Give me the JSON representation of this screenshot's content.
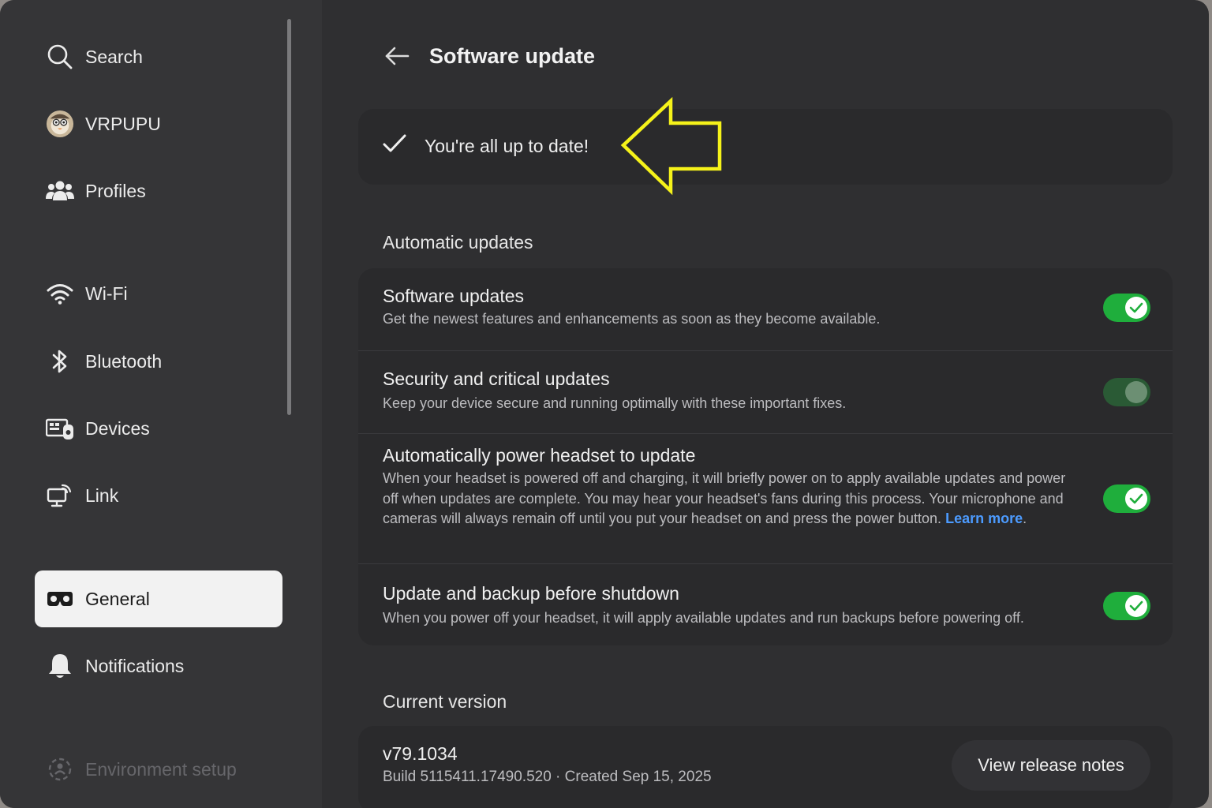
{
  "sidebar": {
    "items": [
      {
        "label": "Search",
        "icon": "search-icon"
      },
      {
        "label": "VRPUPU",
        "icon": "avatar"
      },
      {
        "label": "Profiles",
        "icon": "people-icon"
      },
      {
        "label": "Wi-Fi",
        "icon": "wifi-icon"
      },
      {
        "label": "Bluetooth",
        "icon": "bluetooth-icon"
      },
      {
        "label": "Devices",
        "icon": "devices-icon"
      },
      {
        "label": "Link",
        "icon": "link-icon"
      },
      {
        "label": "General",
        "icon": "headset-icon",
        "active": true
      },
      {
        "label": "Notifications",
        "icon": "bell-icon"
      },
      {
        "label": "Environment setup",
        "icon": "environment-icon",
        "disabled": true
      }
    ]
  },
  "header": {
    "title": "Software update"
  },
  "status": {
    "text": "You're all up to date!"
  },
  "automatic_updates": {
    "section_title": "Automatic updates",
    "rows": [
      {
        "title": "Software updates",
        "description": "Get the newest features and enhancements as soon as they become available.",
        "enabled": true
      },
      {
        "title": "Security and critical updates",
        "description": "Keep your device secure and running optimally with these important fixes.",
        "enabled": true,
        "locked": true
      },
      {
        "title": "Automatically power headset to update",
        "description": "When your headset is powered off and charging, it will briefly power on to apply available updates and power off when updates are complete. You may hear your headset's fans during this process. Your microphone and cameras will always remain off until you put your headset on and press the power button.",
        "link": "Learn more",
        "link_suffix": ".",
        "enabled": true
      },
      {
        "title": "Update and backup before shutdown",
        "description": "When you power off your headset, it will apply available updates and run backups before powering off.",
        "enabled": true
      }
    ]
  },
  "current_version": {
    "section_title": "Current version",
    "version": "v79.1034",
    "build": "Build 5115411.17490.520 · Created Sep 15, 2025",
    "release_notes_label": "View release notes"
  },
  "colors": {
    "toggle_on": "#1fae3c",
    "link": "#4c9bff",
    "annotation_arrow": "#f5f21a"
  }
}
